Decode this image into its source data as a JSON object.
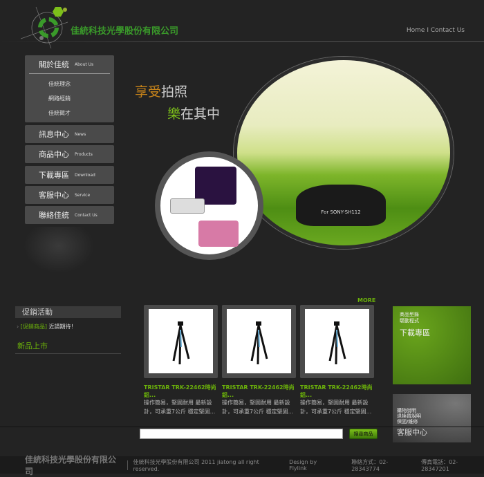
{
  "header": {
    "company": "佳統科技光學股份有限公司",
    "nav": [
      "Home",
      "Contact Us"
    ],
    "nav_sep": "I"
  },
  "menu": [
    {
      "zh": "關於佳統",
      "en": "About Us",
      "sub": [
        "佳統理念",
        "網路經銷",
        "佳統徵才"
      ]
    },
    {
      "zh": "訊息中心",
      "en": "News"
    },
    {
      "zh": "商品中心",
      "en": "Products"
    },
    {
      "zh": "下載專區",
      "en": "Download"
    },
    {
      "zh": "客服中心",
      "en": "Service"
    },
    {
      "zh": "聯絡佳統",
      "en": "Contact Us"
    }
  ],
  "banner": {
    "slogan1a": "享受",
    "slogan1b": "拍照",
    "slogan2a": "樂",
    "slogan2b": "在其中",
    "lens_hood_text": "For SONY-SH112"
  },
  "promo": {
    "title": "促銷活動",
    "item_tag": "[促銷商品]",
    "item_text": "近請期待！",
    "new_title": "新品上市"
  },
  "products": {
    "more": "MORE",
    "items": [
      {
        "title": "TRISTAR TRK-22462時尚鋁...",
        "desc": "操作簡易，堅固耐用 最新設計，可承重7公斤 穩定堅固..."
      },
      {
        "title": "TRISTAR TRK-22462時尚鋁...",
        "desc": "操作簡易，堅固耐用 最新設計，可承重7公斤 穩定堅固..."
      },
      {
        "title": "TRISTAR TRK-22462時尚鋁...",
        "desc": "操作簡易，堅固耐用 最新設計，可承重7公斤 穩定堅固..."
      }
    ]
  },
  "side": {
    "download": {
      "lines": [
        "商品型錄",
        "驅動程式"
      ],
      "title": "下載專區"
    },
    "service": {
      "lines": [
        "購物說明",
        "退換貨說明",
        "保固/維修"
      ],
      "title": "客服中心"
    }
  },
  "search": {
    "value": "",
    "button": "搜尋商品"
  },
  "footer": {
    "company": "佳統科技光學股份有限公司",
    "copyright": "佳統科技光學股份有限公司 2011 jiatong all right reserved.",
    "design": "Design by Flylink",
    "contact": "聯絡方式：02-28343774",
    "fax": "傳真電話：02-28347201"
  },
  "colors": {
    "accent": "#6cb30a",
    "bg": "#232323"
  }
}
